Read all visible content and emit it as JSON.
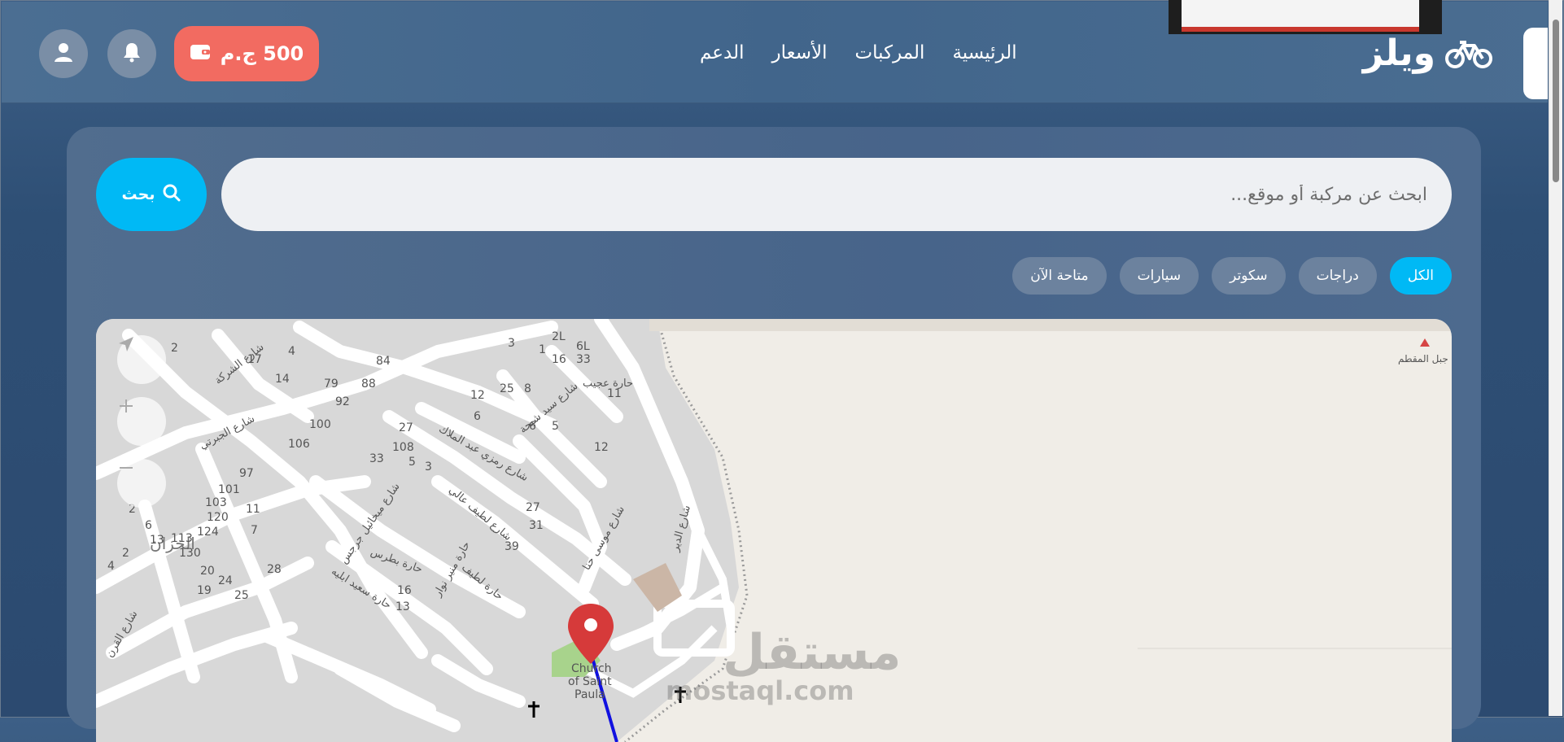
{
  "brand": {
    "name": "ويلز"
  },
  "nav": {
    "items": [
      "الرئيسية",
      "المركبات",
      "الأسعار",
      "الدعم"
    ]
  },
  "wallet": {
    "amount": "500 ج.م"
  },
  "search": {
    "placeholder": "ابحث عن مركبة أو موقع...",
    "button_label": "بحث"
  },
  "filters": {
    "items": [
      "الكل",
      "دراجات",
      "سكوتر",
      "سيارات",
      "متاحة الآن"
    ],
    "active_index": 0
  },
  "map": {
    "place_labels": [
      "الخزان",
      "جبل المقطم",
      "Church",
      "of Saint",
      "Paula"
    ],
    "street_labels": [
      "شارع الشركة",
      "شارع الجبرتي",
      "شارع رمزي عبد الملاك",
      "شارع سيد شيحة",
      "حارة عجيب",
      "شارع ميخائيل جرجس",
      "شارع لطيف عالي",
      "شارع موسى حنا",
      "شارع الدير",
      "حارة بطرس",
      "حارة لطيف",
      "حارة سعيد ابليه",
      "حارة منير نوار",
      "شارع القرن"
    ],
    "house_numbers": [
      "2",
      "4",
      "17",
      "14",
      "84",
      "79",
      "88",
      "92",
      "100",
      "106",
      "3",
      "1",
      "16",
      "33",
      "25",
      "8",
      "11",
      "12",
      "6",
      "27",
      "108",
      "33",
      "5",
      "3",
      "6",
      "5",
      "12",
      "97",
      "101",
      "103",
      "120",
      "11",
      "2",
      "6",
      "13",
      "113",
      "124",
      "7",
      "130",
      "28",
      "20",
      "24",
      "25",
      "19",
      "16",
      "13",
      "39",
      "31",
      "27",
      "2L",
      "6L",
      "4",
      "2"
    ]
  },
  "watermark": {
    "ar": "مستقل",
    "en": "mostaql.com"
  },
  "colors": {
    "accent": "#00b9f5",
    "wallet": "#f26b61",
    "header": "#4b6e92",
    "marker": "#d63a3a",
    "route": "#1010e0"
  }
}
